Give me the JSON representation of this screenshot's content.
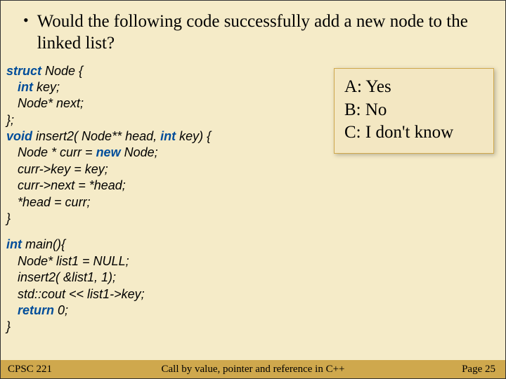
{
  "question": "Would the following code successfully add a new node to the linked list?",
  "code": {
    "l1": "struct",
    "l1b": " Node {",
    "l2a": "int",
    "l2b": " key;",
    "l3": "Node* next;",
    "l4": "};",
    "l5a": "void",
    "l5b": " insert2( Node** head, ",
    "l5c": "int",
    "l5d": " key) {",
    "l6a": "Node * curr = ",
    "l6b": "new",
    "l6c": " Node;",
    "l7": "curr->key  = key;",
    "l8": "curr->next = *head;",
    "l9": "*head = curr;",
    "l10": "}",
    "l11a": "int",
    "l11b": " main(){",
    "l12": "Node* list1 = NULL;",
    "l13": "insert2( &list1, 1);",
    "l14": "std::cout << list1->key;",
    "l15a": "return",
    "l15b": " 0;",
    "l16": "}"
  },
  "answers": {
    "a": "A: Yes",
    "b": "B: No",
    "c": "C: I don't know"
  },
  "footer": {
    "left": "CPSC 221",
    "center": "Call by value, pointer and reference in C++",
    "right": "Page 25"
  }
}
